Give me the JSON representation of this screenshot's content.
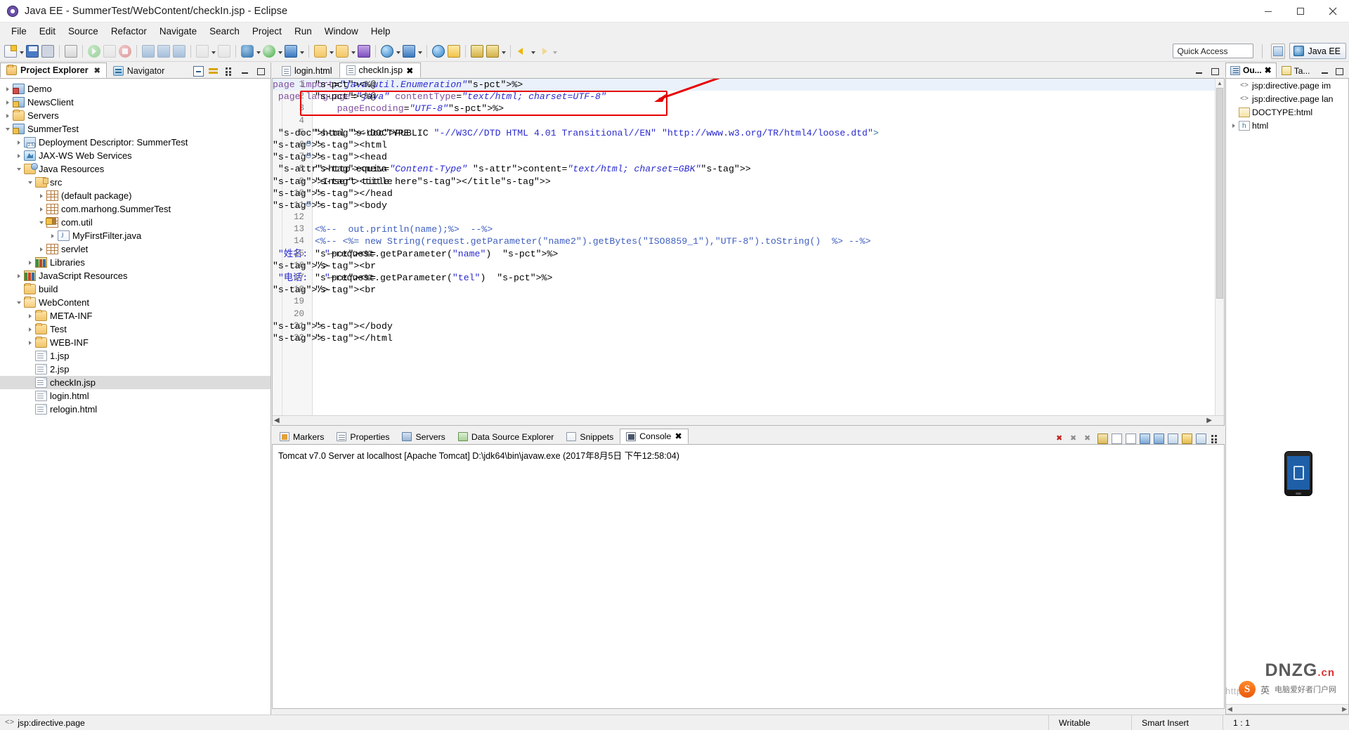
{
  "window": {
    "title": "Java EE - SummerTest/WebContent/checkIn.jsp - Eclipse",
    "app_icon": "eclipse-icon",
    "minimize": "minimize-icon",
    "maximize": "maximize-icon",
    "close": "close-icon"
  },
  "menubar": {
    "items": [
      "File",
      "Edit",
      "Source",
      "Refactor",
      "Navigate",
      "Search",
      "Project",
      "Run",
      "Window",
      "Help"
    ]
  },
  "toolbar": {
    "quick_access_placeholder": "Quick Access",
    "perspective_label": "Java EE",
    "perspective_icon": "java-ee-perspective-icon",
    "open_perspective_icon": "open-perspective-icon"
  },
  "left": {
    "tabs": [
      {
        "label": "Project Explorer",
        "icon": "project-explorer-icon",
        "active": true,
        "closeable": true
      },
      {
        "label": "Navigator",
        "icon": "navigator-icon",
        "active": false,
        "closeable": false
      }
    ],
    "tools": [
      "collapse-all-icon",
      "link-with-editor-icon",
      "view-menu-icon",
      "minimize-icon",
      "maximize-icon"
    ],
    "tree": [
      {
        "label": "Demo",
        "indent": 0,
        "twisty": "right",
        "icon": "project-error-icon",
        "selected": false
      },
      {
        "label": "NewsClient",
        "indent": 0,
        "twisty": "right",
        "icon": "project-warn-icon",
        "selected": false
      },
      {
        "label": "Servers",
        "indent": 0,
        "twisty": "right",
        "icon": "folder-icon",
        "selected": false
      },
      {
        "label": "SummerTest",
        "indent": 0,
        "twisty": "down",
        "icon": "project-warn-icon",
        "selected": false
      },
      {
        "label": "Deployment Descriptor: SummerTest",
        "indent": 1,
        "twisty": "right",
        "icon": "deployment-descriptor-icon",
        "selected": false
      },
      {
        "label": "JAX-WS Web Services",
        "indent": 1,
        "twisty": "right",
        "icon": "jaxws-icon",
        "selected": false
      },
      {
        "label": "Java Resources",
        "indent": 1,
        "twisty": "down",
        "icon": "java-resources-icon",
        "selected": false
      },
      {
        "label": "src",
        "indent": 2,
        "twisty": "down",
        "icon": "source-folder-icon",
        "selected": false
      },
      {
        "label": "(default package)",
        "indent": 3,
        "twisty": "right",
        "icon": "package-icon",
        "selected": false
      },
      {
        "label": "com.marhong.SummerTest",
        "indent": 3,
        "twisty": "right",
        "icon": "package-icon",
        "selected": false
      },
      {
        "label": "com.util",
        "indent": 3,
        "twisty": "down",
        "icon": "package-warn-icon",
        "selected": false
      },
      {
        "label": "MyFirstFilter.java",
        "indent": 4,
        "twisty": "right",
        "icon": "java-file-icon",
        "selected": false
      },
      {
        "label": "servlet",
        "indent": 3,
        "twisty": "right",
        "icon": "package-icon",
        "selected": false
      },
      {
        "label": "Libraries",
        "indent": 2,
        "twisty": "right",
        "icon": "libraries-icon",
        "selected": false
      },
      {
        "label": "JavaScript Resources",
        "indent": 1,
        "twisty": "right",
        "icon": "libraries-icon",
        "selected": false
      },
      {
        "label": "build",
        "indent": 1,
        "twisty": "none",
        "icon": "folder-icon",
        "selected": false
      },
      {
        "label": "WebContent",
        "indent": 1,
        "twisty": "down",
        "icon": "folder-open-icon",
        "selected": false
      },
      {
        "label": "META-INF",
        "indent": 2,
        "twisty": "right",
        "icon": "folder-icon",
        "selected": false
      },
      {
        "label": "Test",
        "indent": 2,
        "twisty": "right",
        "icon": "folder-icon",
        "selected": false
      },
      {
        "label": "WEB-INF",
        "indent": 2,
        "twisty": "right",
        "icon": "folder-icon",
        "selected": false
      },
      {
        "label": "1.jsp",
        "indent": 2,
        "twisty": "none",
        "icon": "file-icon",
        "selected": false
      },
      {
        "label": "2.jsp",
        "indent": 2,
        "twisty": "none",
        "icon": "file-icon",
        "selected": false
      },
      {
        "label": "checkIn.jsp",
        "indent": 2,
        "twisty": "none",
        "icon": "file-icon",
        "selected": true
      },
      {
        "label": "login.html",
        "indent": 2,
        "twisty": "none",
        "icon": "file-icon",
        "selected": false
      },
      {
        "label": "relogin.html",
        "indent": 2,
        "twisty": "none",
        "icon": "file-icon",
        "selected": false
      }
    ]
  },
  "editor": {
    "tabs": [
      {
        "label": "login.html",
        "active": false,
        "closeable": false
      },
      {
        "label": "checkIn.jsp",
        "active": true,
        "closeable": true
      }
    ],
    "lines": [
      {
        "n": 1,
        "fold": "",
        "text": "<%@page import=\"java.util.Enumeration\"%>"
      },
      {
        "n": 2,
        "fold": "",
        "text": "<%@ page language=\"java\" contentType=\"text/html; charset=UTF-8\""
      },
      {
        "n": 3,
        "fold": "",
        "text": "    pageEncoding=\"UTF-8\"%>"
      },
      {
        "n": 4,
        "fold": "",
        "text": ""
      },
      {
        "n": 5,
        "fold": "",
        "text": "<!DOCTYPE html PUBLIC \"-//W3C//DTD HTML 4.01 Transitional//EN\" \"http://www.w3.org/TR/html4/loose.dtd\">"
      },
      {
        "n": 6,
        "fold": "-",
        "text": "<html>"
      },
      {
        "n": 7,
        "fold": "-",
        "text": "<head>"
      },
      {
        "n": 8,
        "fold": "",
        "text": "<meta http-equiv=\"Content-Type\" content=\"text/html; charset=GBK\">"
      },
      {
        "n": 9,
        "fold": "",
        "text": "<title>Insert title here</title>"
      },
      {
        "n": 10,
        "fold": "",
        "text": "</head>"
      },
      {
        "n": 11,
        "fold": "-",
        "text": "<body>"
      },
      {
        "n": 12,
        "fold": "",
        "text": ""
      },
      {
        "n": 13,
        "fold": "",
        "text": "<%--  out.println(name);%>  --%>"
      },
      {
        "n": 14,
        "fold": "",
        "text": "<%-- <%= new String(request.getParameter(\"name2\").getBytes(\"ISO8859_1\"),\"UTF-8\").toString()  %> --%>"
      },
      {
        "n": 15,
        "fold": "",
        "text": "<%= \"姓名:   \"+request.getParameter(\"name\")  %>"
      },
      {
        "n": 16,
        "fold": "",
        "text": "<br/>"
      },
      {
        "n": 17,
        "fold": "",
        "text": "<%= \"电话:   \"+request.getParameter(\"tel\")  %>"
      },
      {
        "n": 18,
        "fold": "",
        "text": "<br/>"
      },
      {
        "n": 19,
        "fold": "",
        "text": ""
      },
      {
        "n": 20,
        "fold": "",
        "text": ""
      },
      {
        "n": 21,
        "fold": "",
        "text": "</body>"
      },
      {
        "n": 22,
        "fold": "",
        "text": "</html>"
      }
    ],
    "annotation": {
      "highlight_box_color": "#e60000",
      "arrow_color": "#e60000"
    }
  },
  "bottom": {
    "tabs": [
      {
        "label": "Markers",
        "icon": "markers-icon",
        "active": false
      },
      {
        "label": "Properties",
        "icon": "properties-icon",
        "active": false
      },
      {
        "label": "Servers",
        "icon": "servers-icon",
        "active": false
      },
      {
        "label": "Data Source Explorer",
        "icon": "data-source-icon",
        "active": false
      },
      {
        "label": "Snippets",
        "icon": "snippets-icon",
        "active": false
      },
      {
        "label": "Console",
        "icon": "console-icon",
        "active": true,
        "closeable": true
      }
    ],
    "console_text": "Tomcat v7.0 Server at localhost [Apache Tomcat] D:\\jdk64\\bin\\javaw.exe (2017年8月5日 下午12:58:04)",
    "tools": [
      "terminate-icon",
      "remove-launch-icon",
      "remove-all-icon",
      "lock-icon",
      "word-wrap-icon",
      "clear-icon",
      "scroll-lock-icon",
      "show-console-icon",
      "pin-console-icon",
      "display-selected-icon",
      "open-console-icon",
      "view-menu-icon"
    ]
  },
  "right": {
    "tabs": [
      {
        "label": "Ou...",
        "icon": "outline-icon",
        "active": true,
        "closeable": true
      },
      {
        "label": "Ta...",
        "icon": "tasks-icon",
        "active": false,
        "closeable": false
      }
    ],
    "outline": [
      {
        "label": "jsp:directive.page im",
        "icon": "tag-icon",
        "twisty": "none",
        "indent": 0
      },
      {
        "label": "jsp:directive.page lan",
        "icon": "tag-icon",
        "twisty": "none",
        "indent": 0
      },
      {
        "label": "DOCTYPE:html",
        "icon": "doctype-icon",
        "twisty": "none",
        "indent": 0
      },
      {
        "label": "html",
        "icon": "html-tag-icon",
        "twisty": "right",
        "indent": 0
      }
    ]
  },
  "statusbar": {
    "left_icon": "tag-icon",
    "left_label": "jsp:directive.page",
    "writable": "Writable",
    "insert_mode": "Smart Insert",
    "position": "1 : 1"
  },
  "watermark": {
    "brand": "DNZG",
    "brand_suffix": ".cn",
    "sogou_text": "英",
    "sogou_sub": "电脑爱好者门户网",
    "url": "http://"
  }
}
